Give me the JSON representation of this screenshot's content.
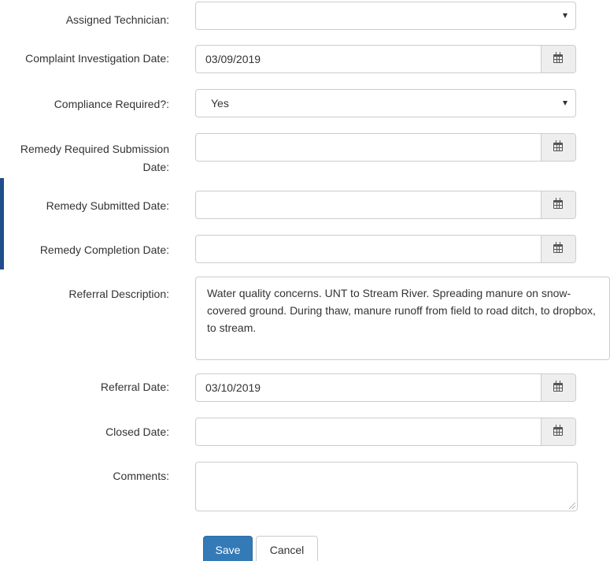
{
  "form": {
    "assigned_technician": {
      "label": "Assigned Technician:",
      "value": ""
    },
    "complaint_investigation_date": {
      "label": "Complaint Investigation Date:",
      "value": "03/09/2019"
    },
    "compliance_required": {
      "label": "Compliance Required?:",
      "value": "Yes"
    },
    "remedy_required_submission_date": {
      "label_line1": "Remedy Required Submission",
      "label_line2": "Date:",
      "value": ""
    },
    "remedy_submitted_date": {
      "label": "Remedy Submitted Date:",
      "value": ""
    },
    "remedy_completion_date": {
      "label": "Remedy Completion Date:",
      "value": ""
    },
    "referral_description": {
      "label": "Referral Description:",
      "value": "Water quality concerns. UNT to Stream River. Spreading manure on snow-covered ground. During thaw, manure runoff from field to road ditch, to dropbox, to stream."
    },
    "referral_date": {
      "label": "Referral Date:",
      "value": "03/10/2019"
    },
    "closed_date": {
      "label": "Closed Date:",
      "value": ""
    },
    "comments": {
      "label": "Comments:",
      "value": ""
    }
  },
  "buttons": {
    "save": "Save",
    "cancel": "Cancel"
  },
  "icons": {
    "date_addon": "calendar-icon",
    "select_caret": "caret-down-icon"
  },
  "colors": {
    "primary_button": "#337ab7",
    "side_tab": "#1f4e8c"
  }
}
